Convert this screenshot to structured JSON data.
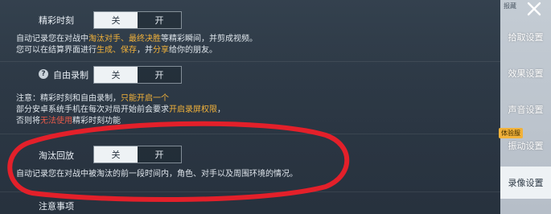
{
  "settings": {
    "highlight": {
      "label": "精彩时刻",
      "toggle": {
        "off_label": "关",
        "on_label": "开",
        "selected": "关"
      },
      "desc_line1": {
        "a": "自动记录您在对战中",
        "b": "淘汰对手、最终决胜",
        "c": "等精彩瞬间，并剪成视频。"
      },
      "desc_line2": {
        "a": "您可以在结算界面进行",
        "b": "生成、保存",
        "c": "，并",
        "d": "分享",
        "e": "给你的朋友。"
      }
    },
    "free_record": {
      "help_icon": "?",
      "label": "自由录制",
      "toggle": {
        "off_label": "关",
        "on_label": "开",
        "selected": "关"
      },
      "note_line1": {
        "a": "注意：精彩时刻和自由录制，",
        "b": "只能开启一个"
      },
      "note_line2": {
        "a": "部分安卓系统手机在每次对局开始前会要求",
        "b": "开启录屏权限",
        "c": "，"
      },
      "note_line3": {
        "a": "否则将",
        "b": "无法使用",
        "c": "精彩时刻功能"
      }
    },
    "elimination_replay": {
      "label": "淘汰回放",
      "toggle": {
        "off_label": "关",
        "on_label": "开",
        "selected": "关"
      },
      "desc": "自动记录您在对战中被淘汰的前一段时间内，角色、对手以及周围环境的情况。"
    },
    "notes_heading": "注意事项"
  },
  "sidebar": {
    "top_tab": "报藏",
    "items": [
      {
        "label": "拾取设置"
      },
      {
        "label": "效果设置"
      },
      {
        "label": "声音设置"
      },
      {
        "label": "振动设置"
      },
      {
        "label": "录像设置"
      }
    ],
    "badge": "体验服",
    "active_index": 4
  },
  "colors": {
    "highlight": "#f2b23a",
    "warning": "#e85a4a",
    "annotation": "#e3202a"
  },
  "icons": {
    "close": "close-icon",
    "help": "help-icon"
  }
}
